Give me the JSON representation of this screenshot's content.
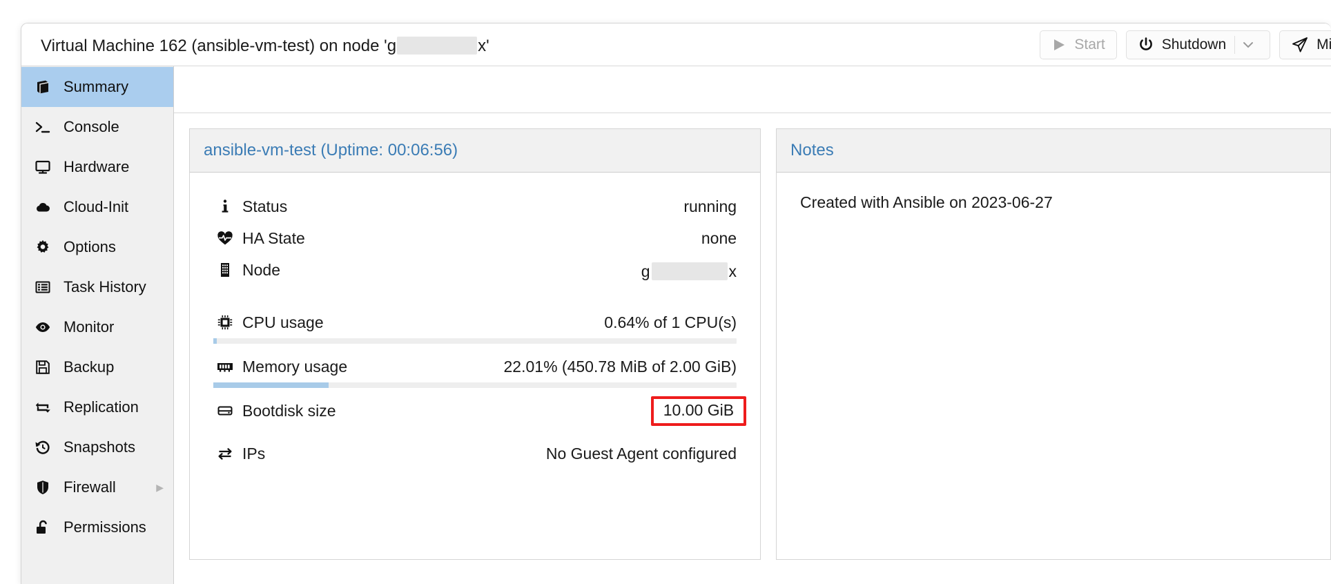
{
  "window": {
    "title_prefix": "Virtual Machine 162 (ansible-vm-test) on node '",
    "title_node_visible_start": "g",
    "title_node_visible_end": "x'",
    "title_node_redacted": true
  },
  "toolbar": {
    "buttons": [
      {
        "label": "Start",
        "icon": "play-icon",
        "disabled": true,
        "split": false
      },
      {
        "label": "Shutdown",
        "icon": "power-icon",
        "disabled": false,
        "split": true
      },
      {
        "label": "Mig",
        "icon": "migrate-icon",
        "disabled": false,
        "split": false,
        "truncated": true
      }
    ],
    "split_caret": "⌄"
  },
  "sidebar": {
    "items": [
      {
        "label": "Summary",
        "icon": "book-icon",
        "active": true,
        "expandable": false
      },
      {
        "label": "Console",
        "icon": "terminal-icon",
        "active": false,
        "expandable": false
      },
      {
        "label": "Hardware",
        "icon": "monitor-icon",
        "active": false,
        "expandable": false
      },
      {
        "label": "Cloud-Init",
        "icon": "cloud-icon",
        "active": false,
        "expandable": false
      },
      {
        "label": "Options",
        "icon": "gear-icon",
        "active": false,
        "expandable": false
      },
      {
        "label": "Task History",
        "icon": "list-icon",
        "active": false,
        "expandable": false
      },
      {
        "label": "Monitor",
        "icon": "eye-icon",
        "active": false,
        "expandable": false
      },
      {
        "label": "Backup",
        "icon": "floppy-icon",
        "active": false,
        "expandable": false
      },
      {
        "label": "Replication",
        "icon": "replication-icon",
        "active": false,
        "expandable": false
      },
      {
        "label": "Snapshots",
        "icon": "history-icon",
        "active": false,
        "expandable": false
      },
      {
        "label": "Firewall",
        "icon": "shield-icon",
        "active": false,
        "expandable": true
      },
      {
        "label": "Permissions",
        "icon": "unlock-icon",
        "active": false,
        "expandable": false
      }
    ],
    "expand_arrow": "▶"
  },
  "status_panel": {
    "header": "ansible-vm-test (Uptime: 00:06:56)",
    "rows": [
      {
        "label": "Status",
        "icon": "info-icon",
        "value": "running"
      },
      {
        "label": "HA State",
        "icon": "heartbeat-icon",
        "value": "none"
      },
      {
        "label": "Node",
        "icon": "server-icon",
        "value_start": "g",
        "value_end": "x",
        "redacted": true
      }
    ],
    "usage": [
      {
        "label": "CPU usage",
        "icon": "cpu-icon",
        "value": "0.64% of 1 CPU(s)",
        "percent": 0.64,
        "bar_color": "#a8cbe8"
      },
      {
        "label": "Memory usage",
        "icon": "memory-icon",
        "value": "22.01% (450.78 MiB of 2.00 GiB)",
        "percent": 22.01,
        "bar_color": "#a8cbe8"
      }
    ],
    "bootdisk": {
      "label": "Bootdisk size",
      "icon": "disk-icon",
      "value": "10.00 GiB",
      "highlighted": true,
      "highlight_color": "#ee1c1c"
    },
    "ips": {
      "label": "IPs",
      "icon": "exchange-icon",
      "value": "No Guest Agent configured"
    }
  },
  "notes_panel": {
    "header": "Notes",
    "text": "Created with Ansible on 2023-06-27"
  },
  "colors": {
    "accent_blue": "#3b7cb5",
    "active_nav": "#aacdee",
    "meter_fill": "#a8cbe8",
    "annotation_red": "#ee1c1c",
    "panel_header_bg": "#f1f1f1",
    "sidebar_bg": "#f0f0f0"
  }
}
